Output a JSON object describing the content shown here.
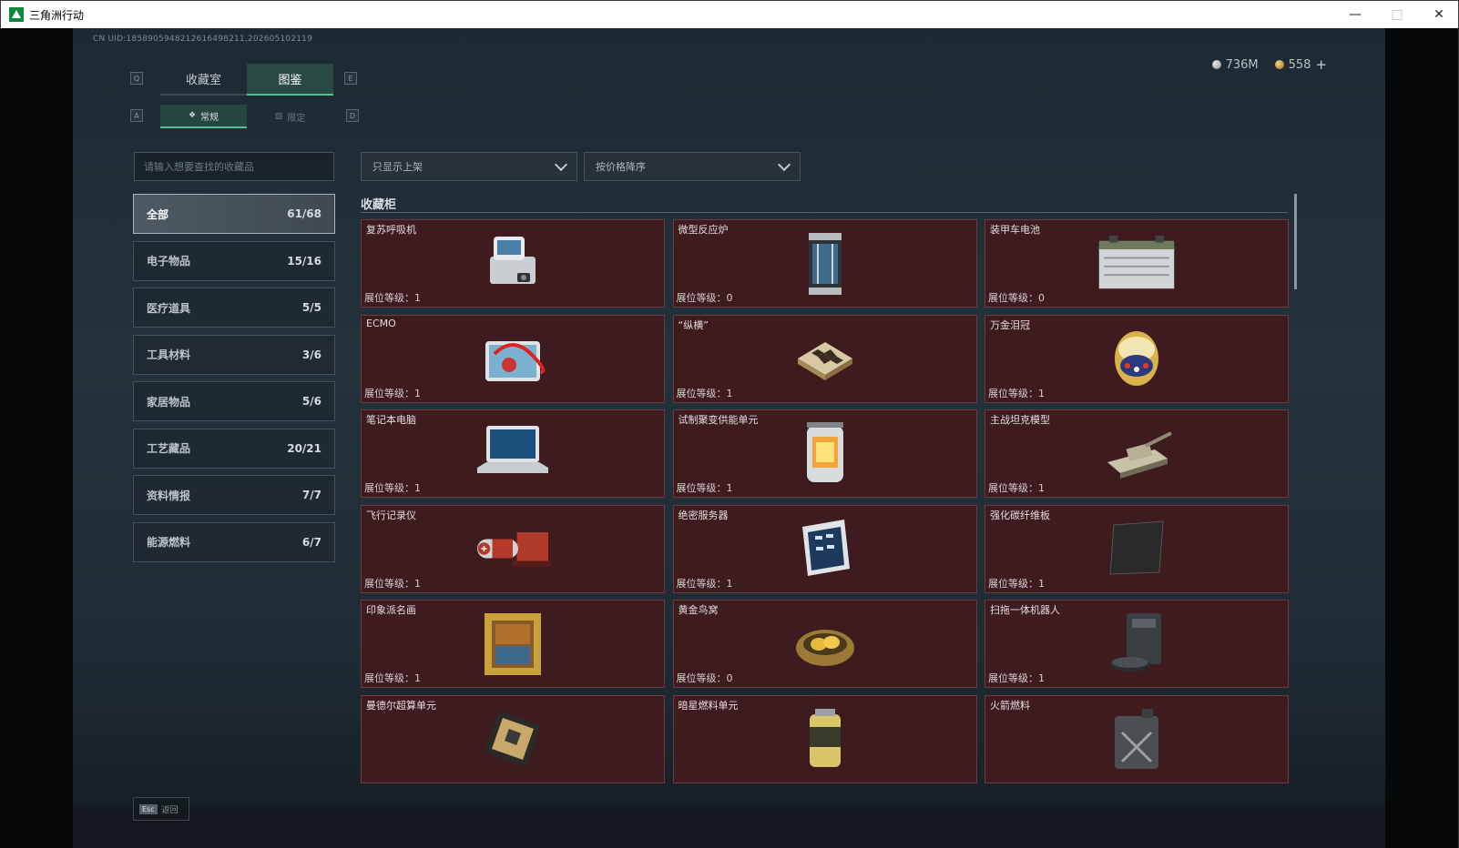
{
  "window": {
    "title": "三角洲行动"
  },
  "header": {
    "uid": "CN UID:1858905948212616498211,202605102119"
  },
  "currency": {
    "silver": "736M",
    "gold": "558",
    "plus": "+"
  },
  "tabs": [
    {
      "label": "收藏室"
    },
    {
      "label": "图鉴"
    }
  ],
  "tab_keys": {
    "left": "Q",
    "right": "E"
  },
  "subtabs": [
    {
      "label": "常规"
    },
    {
      "label": "限定"
    }
  ],
  "subtab_keys": {
    "left": "A",
    "right": "D"
  },
  "search": {
    "placeholder": "请输入想要查找的收藏品"
  },
  "filters": {
    "shelf": "只显示上架",
    "sort": "按价格降序"
  },
  "categories": [
    {
      "label": "全部",
      "count": "61/68"
    },
    {
      "label": "电子物品",
      "count": "15/16"
    },
    {
      "label": "医疗道具",
      "count": "5/5"
    },
    {
      "label": "工具材料",
      "count": "3/6"
    },
    {
      "label": "家居物品",
      "count": "5/6"
    },
    {
      "label": "工艺藏品",
      "count": "20/21"
    },
    {
      "label": "资料情报",
      "count": "7/7"
    },
    {
      "label": "能源燃料",
      "count": "6/7"
    }
  ],
  "section": {
    "title": "收藏柜"
  },
  "level_prefix": "展位等级：",
  "items": [
    {
      "name": "复苏呼吸机",
      "level": "展位等级：1",
      "icon": "ventilator-icon"
    },
    {
      "name": "微型反应炉",
      "level": "展位等级：0",
      "icon": "reactor-icon"
    },
    {
      "name": "装甲车电池",
      "level": "展位等级：0",
      "icon": "battery-icon"
    },
    {
      "name": "ECMO",
      "level": "展位等级：1",
      "icon": "ecmo-icon"
    },
    {
      "name": "“纵横”",
      "level": "展位等级：1",
      "icon": "chessboard-icon"
    },
    {
      "name": "万金泪冠",
      "level": "展位等级：1",
      "icon": "jeweled-egg-icon"
    },
    {
      "name": "笔记本电脑",
      "level": "展位等级：1",
      "icon": "laptop-icon"
    },
    {
      "name": "试制聚变供能单元",
      "level": "展位等级：1",
      "icon": "fusion-unit-icon"
    },
    {
      "name": "主战坦克模型",
      "level": "展位等级：1",
      "icon": "tank-model-icon"
    },
    {
      "name": "飞行记录仪",
      "level": "展位等级：1",
      "icon": "flight-recorder-icon"
    },
    {
      "name": "绝密服务器",
      "level": "展位等级：1",
      "icon": "server-icon"
    },
    {
      "name": "强化碳纤维板",
      "level": "展位等级：1",
      "icon": "carbon-plate-icon"
    },
    {
      "name": "印象派名画",
      "level": "展位等级：1",
      "icon": "painting-icon"
    },
    {
      "name": "黄金鸟窝",
      "level": "展位等级：0",
      "icon": "golden-nest-icon"
    },
    {
      "name": "扫拖一体机器人",
      "level": "展位等级：1",
      "icon": "robot-vacuum-icon"
    },
    {
      "name": "曼德尔超算单元",
      "level": "",
      "icon": "supercompute-icon"
    },
    {
      "name": "暗星燃料单元",
      "level": "",
      "icon": "fuel-cell-icon"
    },
    {
      "name": "火箭燃料",
      "level": "",
      "icon": "jerrycan-icon"
    }
  ],
  "footer": {
    "esc_key": "Esc",
    "esc_label": "返回"
  },
  "colors": {
    "accent": "#4bc88a",
    "card_bg": "#3d1b1e",
    "card_border": "#6e3a3e",
    "bg": "#1f2c35"
  }
}
